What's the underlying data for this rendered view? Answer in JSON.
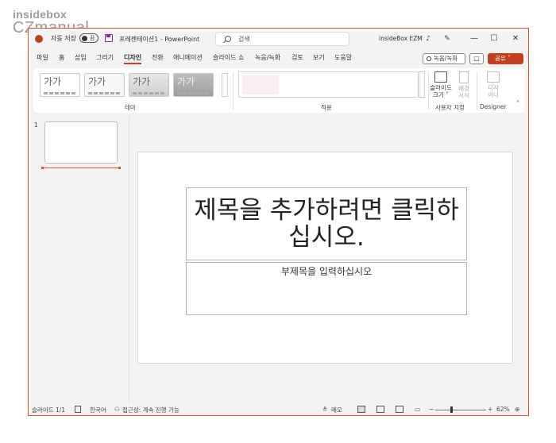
{
  "watermark": {
    "line1": "insidebox",
    "line2": "CZmanual"
  },
  "titlebar": {
    "autosave_label": "자동 저장",
    "toggle_state": "끔",
    "doc_title": "프레젠테이션1 - PowerPoint",
    "search_placeholder": "검색",
    "account": "insideBox EZM",
    "minimize": "—",
    "maximize": "☐",
    "close": "✕"
  },
  "tabs": [
    "파일",
    "홈",
    "삽입",
    "그리기",
    "디자인",
    "전환",
    "애니메이션",
    "슬라이드 쇼",
    "녹음/녹화",
    "검토",
    "보기",
    "도움말"
  ],
  "active_tab": "디자인",
  "actions": {
    "record": "녹음/녹화",
    "comment": "□",
    "share": "공유"
  },
  "ribbon": {
    "theme_sample_text": "가가",
    "group_themes": "테마",
    "group_variants": "적용",
    "slide_size_label_1": "슬라이드",
    "slide_size_label_2": "크기 ˅",
    "format_bg_1": "배경",
    "format_bg_2": "서식",
    "designer_btn_1": "디자",
    "designer_btn_2": "이너",
    "group_customize": "사용자 지정",
    "group_designer": "Designer",
    "collapse_icon": "˅"
  },
  "thumbnails": {
    "number": "1"
  },
  "slide": {
    "title_placeholder": "제목을 추가하려면 클릭하십시오.",
    "subtitle_placeholder": "부제목을 입력하십시오"
  },
  "status": {
    "slide_count": "슬라이드 1/1",
    "language": "한국어",
    "accessibility": "접근성: 계속 진행 가능",
    "notes": "메모",
    "zoom_minus": "−",
    "zoom_plus": "+",
    "zoom_level": "62%"
  },
  "colors": {
    "accent": "#c43e1c",
    "border": "#d4562d"
  }
}
